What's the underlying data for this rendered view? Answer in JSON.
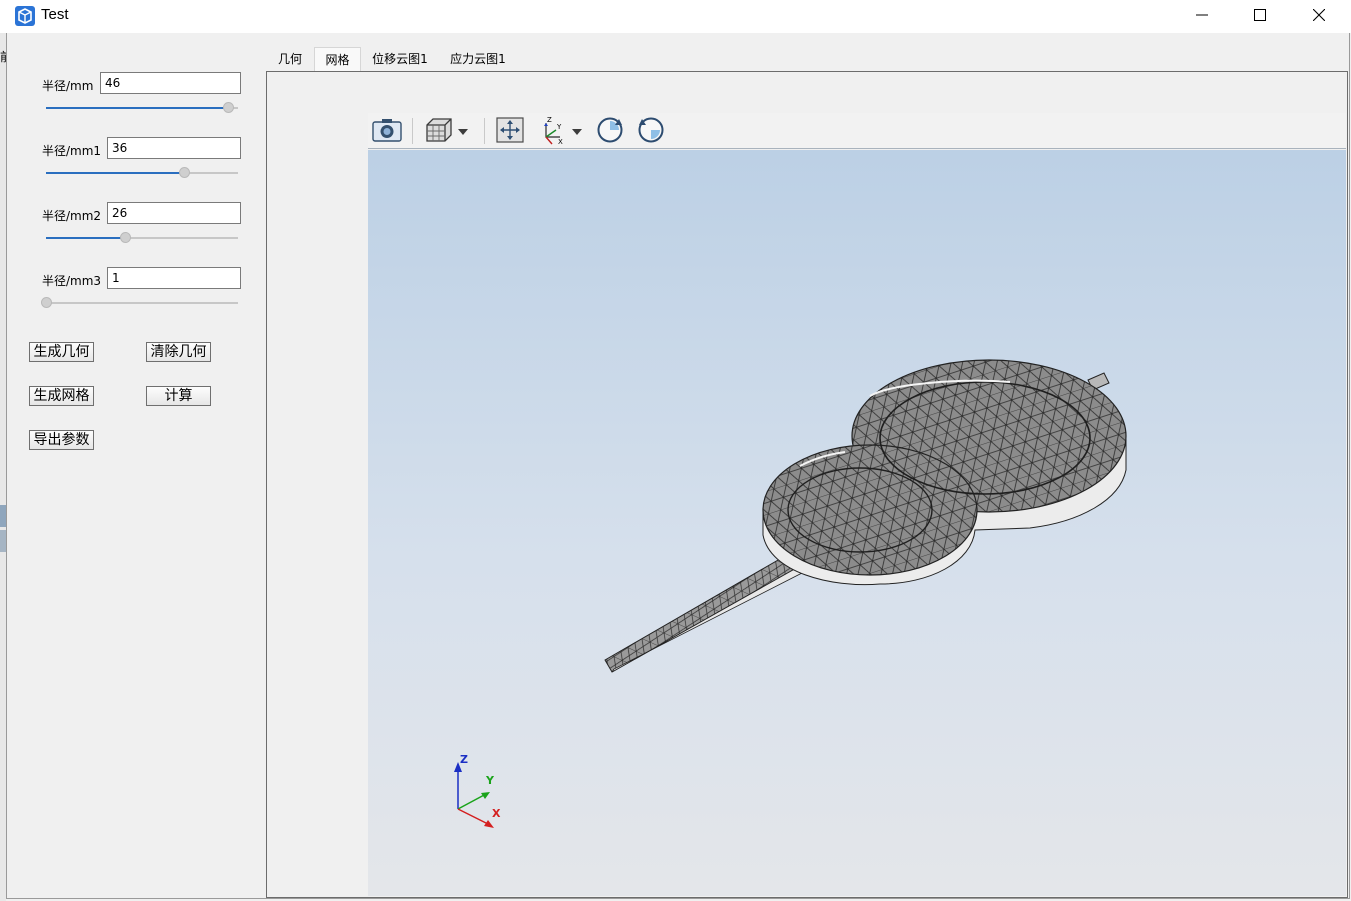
{
  "window": {
    "title": "Test",
    "icon": "app-cube-icon"
  },
  "window_controls": [
    "minimize-icon",
    "maximize-icon",
    "close-icon"
  ],
  "params": [
    {
      "label": "半径/mm",
      "value": "46",
      "slider": 0.95
    },
    {
      "label": "半径/mm1",
      "value": "36",
      "slider": 0.72
    },
    {
      "label": "半径/mm2",
      "value": "26",
      "slider": 0.41
    },
    {
      "label": "半径/mm3",
      "value": "1",
      "slider": 0.0
    }
  ],
  "buttons": {
    "generate_geometry": "生成几何",
    "clear_geometry": "清除几何",
    "generate_mesh": "生成网格",
    "compute": "计算",
    "export_params": "导出参数"
  },
  "tabs": [
    {
      "label": "几何",
      "active": false
    },
    {
      "label": "网格",
      "active": true
    },
    {
      "label": "位移云图1",
      "active": false
    },
    {
      "label": "应力云图1",
      "active": false
    }
  ],
  "toolbar": [
    "camera-icon",
    "view-cube-icon",
    "fit-all-icon",
    "axes-orientation-icon",
    "rotate-cw-icon",
    "rotate-ccw-icon"
  ],
  "axes": {
    "z": "Z",
    "y": "Y",
    "x": "X"
  },
  "colors": {
    "accent": "#2a6ebf",
    "mesh_fill": "#8c8c8c",
    "viewport_top": "#bcd0e5",
    "viewport_bottom": "#e4e6ea"
  }
}
